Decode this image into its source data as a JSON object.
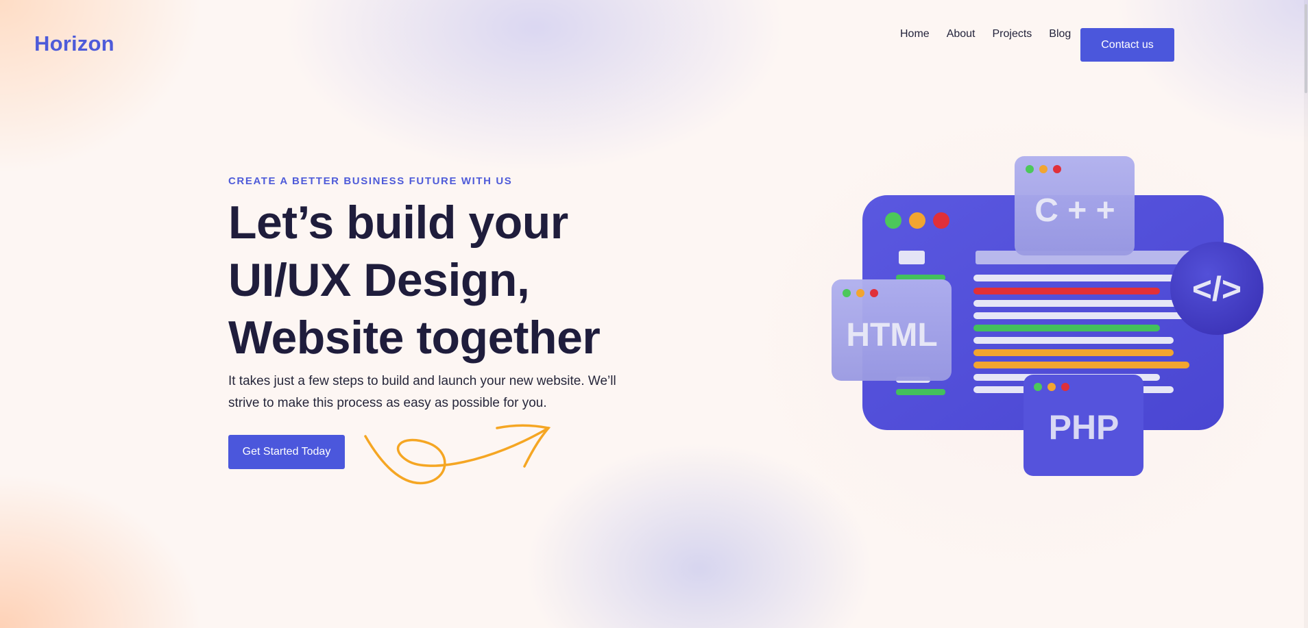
{
  "brand": {
    "name": "Horizon",
    "accent_color": "#4b57dc",
    "heading_color": "#1f1d3c",
    "squiggle_color": "#f5a623"
  },
  "nav": {
    "items": [
      {
        "label": "Home"
      },
      {
        "label": "About"
      },
      {
        "label": "Projects"
      },
      {
        "label": "Blog"
      }
    ],
    "contact_label": "Contact us"
  },
  "hero": {
    "eyebrow": "CREATE A BETTER BUSINESS FUTURE WITH US",
    "headline_lines": [
      "Let’s build your",
      "UI/UX Design,",
      "Website together"
    ],
    "subtext": "It takes just a few steps to build and launch your new website. We’ll strive to make this process as easy as possible for you.",
    "cta_label": "Get Started Today"
  },
  "illustration": {
    "windows": [
      {
        "label": "C + +"
      },
      {
        "label": "HTML"
      },
      {
        "label": "PHP"
      }
    ],
    "code_badge": "</>"
  }
}
